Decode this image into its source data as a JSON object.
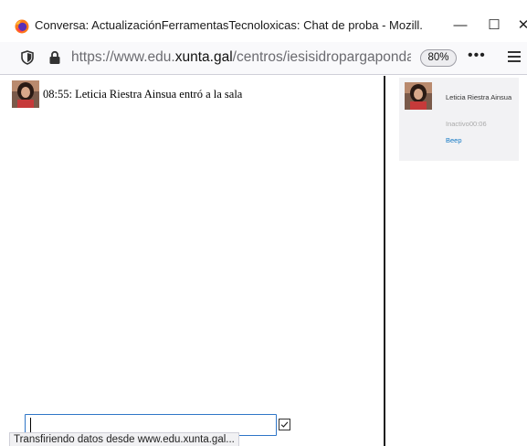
{
  "window": {
    "title": "Conversa: ActualizaciónFerramentasTecnoloxicas: Chat de proba - Mozill...",
    "minimize": "—",
    "maximize": "☐",
    "close": "✕"
  },
  "nav": {
    "url_prefix": "https://www.edu.",
    "url_host": "xunta.gal",
    "url_path": "/centros/iesisidropargapondal/aula",
    "zoom": "80%",
    "menu_dots": "•••"
  },
  "chat": {
    "message": "08:55: Leticia Riestra Ainsua entró a la sala",
    "input_value": "",
    "input_placeholder": ""
  },
  "users": {
    "name": "Leticia Riestra Ainsua",
    "status": "Inactivo00:06",
    "beep": "Beep"
  },
  "statusbar": {
    "text": "Transfiriendo datos desde www.edu.xunta.gal..."
  },
  "colors": {
    "link": "#1177c4",
    "input_border": "#2f76c7",
    "panel_bg": "#f2f2f4"
  },
  "icons": [
    "firefox-icon",
    "shield-icon",
    "lock-icon",
    "hamburger-menu-icon",
    "checkbox-icon",
    "avatar"
  ]
}
